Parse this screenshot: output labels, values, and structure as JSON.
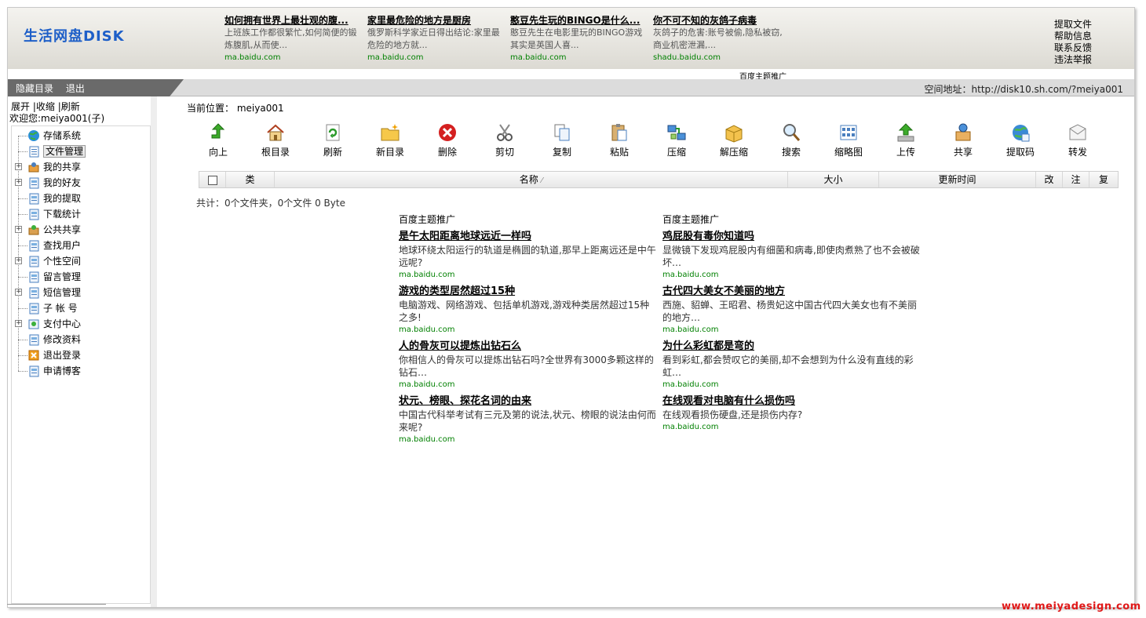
{
  "header": {
    "logo": "生活网盘DISK",
    "ads": [
      {
        "title": "如何拥有世界上最壮观的腹...",
        "desc": "上班族工作都很繁忙,如何简便的锻炼腹肌,从而使...",
        "url": "ma.baidu.com"
      },
      {
        "title": "家里最危险的地方是厨房",
        "desc": "俄罗斯科学家近日得出结论:家里最危险的地方就...",
        "url": "ma.baidu.com"
      },
      {
        "title": "憨豆先生玩的BINGO是什么...",
        "desc": "憨豆先生在电影里玩的BINGO游戏其实是英国人喜...",
        "url": "ma.baidu.com"
      },
      {
        "title": "你不可不知的灰鸽子病毒",
        "desc": "灰鸽子的危害:账号被偷,隐私被窃,商业机密泄漏,...",
        "url": "shadu.baidu.com"
      }
    ],
    "right_links": [
      "提取文件",
      "帮助信息",
      "联系反馈",
      "违法举报"
    ],
    "promo_label": "百度主题推广"
  },
  "navbar": {
    "hide_dir": "隐藏目录",
    "logout": "退出",
    "space_address": "空间地址：http://disk10.sh.com/?meiya001"
  },
  "sidebar": {
    "expand": "展开",
    "collapse": "收缩",
    "refresh": "刷新",
    "sep": "|",
    "welcome": "欢迎您:meiya001(子)",
    "items": [
      {
        "label": "存储系统",
        "icon": "globe-icon",
        "plus": false
      },
      {
        "label": "文件管理",
        "icon": "folder-page-icon",
        "plus": false
      },
      {
        "label": "我的共享",
        "icon": "share-icon",
        "plus": true
      },
      {
        "label": "我的好友",
        "icon": "friends-icon",
        "plus": true
      },
      {
        "label": "我的提取",
        "icon": "extract-icon",
        "plus": false
      },
      {
        "label": "下载统计",
        "icon": "stats-icon",
        "plus": false
      },
      {
        "label": "公共共享",
        "icon": "public-share-icon",
        "plus": true
      },
      {
        "label": "查找用户",
        "icon": "find-user-icon",
        "plus": false
      },
      {
        "label": "个性空间",
        "icon": "personal-space-icon",
        "plus": true
      },
      {
        "label": "留言管理",
        "icon": "message-icon",
        "plus": false
      },
      {
        "label": "短信管理",
        "icon": "sms-icon",
        "plus": true
      },
      {
        "label": "子 帐 号",
        "icon": "sub-account-icon",
        "plus": false
      },
      {
        "label": "支付中心",
        "icon": "payment-icon",
        "plus": true
      },
      {
        "label": "修改资料",
        "icon": "edit-profile-icon",
        "plus": false
      },
      {
        "label": "退出登录",
        "icon": "logout-icon",
        "plus": false
      },
      {
        "label": "申请博客",
        "icon": "blog-icon",
        "plus": false
      }
    ]
  },
  "main": {
    "location_label": "当前位置：",
    "location_value": "meiya001",
    "toolbar": [
      {
        "label": "向上",
        "icon": "up-icon"
      },
      {
        "label": "根目录",
        "icon": "home-icon"
      },
      {
        "label": "刷新",
        "icon": "refresh-icon"
      },
      {
        "label": "新目录",
        "icon": "new-folder-icon"
      },
      {
        "label": "删除",
        "icon": "delete-icon"
      },
      {
        "label": "剪切",
        "icon": "cut-icon"
      },
      {
        "label": "复制",
        "icon": "copy-icon"
      },
      {
        "label": "粘贴",
        "icon": "paste-icon"
      },
      {
        "label": "压缩",
        "icon": "compress-icon"
      },
      {
        "label": "解压缩",
        "icon": "decompress-icon"
      },
      {
        "label": "搜索",
        "icon": "search-icon"
      },
      {
        "label": "缩略图",
        "icon": "thumbnail-icon"
      },
      {
        "label": "上传",
        "icon": "upload-icon"
      },
      {
        "label": "共享",
        "icon": "share-icon"
      },
      {
        "label": "提取码",
        "icon": "extract-code-icon"
      },
      {
        "label": "转发",
        "icon": "forward-icon"
      }
    ],
    "columns": {
      "type": "类",
      "name": "名称",
      "sort": "⁄",
      "size": "大小",
      "updated": "更新时间",
      "edit": "改",
      "note": "注",
      "copy": "复"
    },
    "summary": "共计：0个文件夹，0个文件  0 Byte"
  },
  "ads": {
    "left": {
      "header": "百度主题推广",
      "items": [
        {
          "title": "是午太阳距离地球远近一样吗",
          "desc": "地球环绕太阳运行的轨道是椭圆的轨道,那早上距离远还是中午远呢?",
          "url": "ma.baidu.com"
        },
        {
          "title": "游戏的类型居然超过15种",
          "desc": "电脑游戏、网络游戏、包括单机游戏,游戏种类居然超过15种之多!",
          "url": "ma.baidu.com"
        },
        {
          "title": "人的骨灰可以提炼出钻石么",
          "desc": "你相信人的骨灰可以提炼出钻石吗?全世界有3000多颗这样的钻石…",
          "url": "ma.baidu.com"
        },
        {
          "title": "状元、榜眼、探花名词的由来",
          "desc": "中国古代科举考试有三元及第的说法,状元、榜眼的说法由何而来呢?",
          "url": "ma.baidu.com"
        }
      ]
    },
    "right": {
      "header": "百度主题推广",
      "items": [
        {
          "title": "鸡屁股有毒你知道吗",
          "desc": "显微镜下发现鸡屁股内有细菌和病毒,即使肉煮熟了也不会被破坏…",
          "url": "ma.baidu.com"
        },
        {
          "title": "古代四大美女不美丽的地方",
          "desc": "西施、貂蝉、王昭君、杨贵妃这中国古代四大美女也有不美丽的地方…",
          "url": "ma.baidu.com"
        },
        {
          "title": "为什么彩虹都是弯的",
          "desc": "看到彩虹,都会赞叹它的美丽,却不会想到为什么没有直线的彩虹…",
          "url": "ma.baidu.com"
        },
        {
          "title": "在线观看对电脑有什么损伤吗",
          "desc": "在线观看损伤硬盘,还是损伤内存?",
          "url": "ma.baidu.com"
        }
      ]
    }
  },
  "watermark": "www.meiyadesign.com"
}
